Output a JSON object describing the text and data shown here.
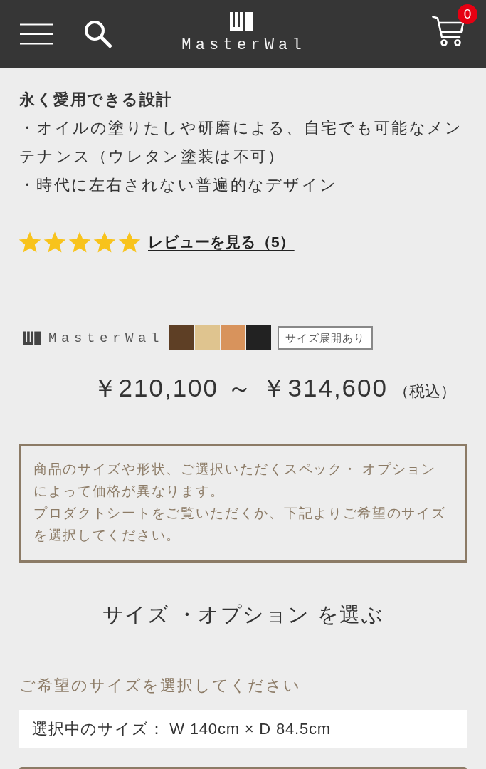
{
  "header": {
    "logo_text": "MasterWal",
    "cart_count": "0"
  },
  "features": {
    "title": "永く愛用できる設計",
    "items": [
      "・オイルの塗りたしや研磨による、自宅でも可能なメンテナンス（ウレタン塗装は不可）",
      "・時代に左右されない普遍的なデザイン"
    ]
  },
  "reviews": {
    "stars": 5,
    "link": "レビューを見る（5）"
  },
  "product": {
    "brand": "MasterWal",
    "swatches": [
      {
        "color": "#5e3f25"
      },
      {
        "color": "#dfc48f"
      },
      {
        "color": "#d8935c"
      },
      {
        "color": "#222222"
      }
    ],
    "badge": "サイズ展開あり",
    "price": "￥210,100 ～ ￥314,600",
    "tax_note": "（税込）"
  },
  "notice": {
    "paragraphs": [
      "商品のサイズや形状、ご選択いただくスペック・ オプションによって価格が異なります。",
      "プロダクトシートをご覧いただくか、下記よりご希望のサイズを選択してください。"
    ]
  },
  "options": {
    "heading": "サイズ ・オプション を選ぶ",
    "prompt": "ご希望のサイズを選択してください",
    "selected_size": "選択中のサイズ： W 140cm × D 84.5cm"
  }
}
